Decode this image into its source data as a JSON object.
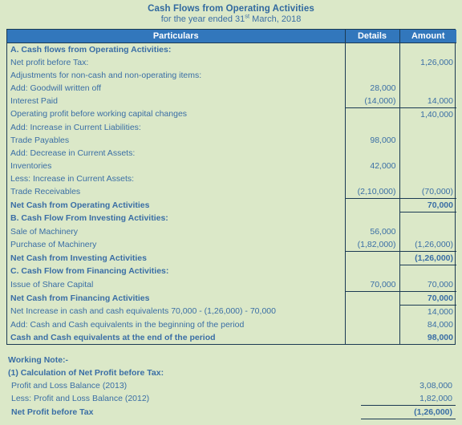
{
  "document": {
    "title": "Cash Flows from Operating Activities",
    "subtitle_prefix": "for the year ended 31",
    "subtitle_sup": "st",
    "subtitle_suffix": " March, 2018"
  },
  "colors": {
    "page_background": "#dbe8c8",
    "header_blue": "#3277bc",
    "text_blue": "#3a6ea5",
    "border": "#1b3a53",
    "header_text": "#ffffff"
  },
  "table": {
    "columns": [
      "Particulars",
      "Details",
      "Amount"
    ],
    "rows": [
      {
        "particulars": "A. Cash flows from Operating Activities:",
        "details": "",
        "amount": "",
        "bold": true,
        "indent": 0,
        "align": "left"
      },
      {
        "particulars": "Net profit before Tax:",
        "details": "",
        "amount": "1,26,000",
        "bold": false,
        "indent": 0,
        "align": "left"
      },
      {
        "particulars": "Adjustments for non-cash and non-operating items:",
        "details": "",
        "amount": "",
        "bold": false,
        "indent": 0,
        "align": "left"
      },
      {
        "particulars": "Add: Goodwill written off",
        "details": "28,000",
        "amount": "",
        "bold": false,
        "indent": 0,
        "align": "left"
      },
      {
        "particulars": "Interest Paid",
        "details": "(14,000)",
        "amount": "14,000",
        "bold": false,
        "indent": 1,
        "align": "left",
        "rule_below_details": true,
        "rule_below_amount": true
      },
      {
        "particulars": "Operating profit before working capital changes",
        "details": "",
        "amount": "1,40,000",
        "bold": false,
        "indent": 0,
        "align": "left"
      },
      {
        "particulars": "Add: Increase in Current Liabilities:",
        "details": "",
        "amount": "",
        "bold": false,
        "indent": 0,
        "align": "left"
      },
      {
        "particulars": "Trade Payables",
        "details": "98,000",
        "amount": "",
        "bold": false,
        "indent": 1,
        "align": "left"
      },
      {
        "particulars": "Add: Decrease in Current Assets:",
        "details": "",
        "amount": "",
        "bold": false,
        "indent": 0,
        "align": "left"
      },
      {
        "particulars": "Inventories",
        "details": "42,000",
        "amount": "",
        "bold": false,
        "indent": 1,
        "align": "left"
      },
      {
        "particulars": "Less: Increase in Current Assets:",
        "details": "",
        "amount": "",
        "bold": false,
        "indent": 0,
        "align": "left"
      },
      {
        "particulars": "Trade Receivables",
        "details": "(2,10,000)",
        "amount": "(70,000)",
        "bold": false,
        "indent": 1,
        "align": "left",
        "rule_below_details": true,
        "rule_below_amount": true
      },
      {
        "particulars": "Net Cash from Operating Activities",
        "details": "",
        "amount": "70,000",
        "bold": true,
        "indent": 0,
        "align": "right",
        "rule_below_amount": true
      },
      {
        "particulars": "B. Cash Flow From Investing Activities:",
        "details": "",
        "amount": "",
        "bold": true,
        "indent": 0,
        "align": "left"
      },
      {
        "particulars": "Sale of Machinery",
        "details": "56,000",
        "amount": "",
        "bold": false,
        "indent": 0,
        "align": "left"
      },
      {
        "particulars": "Purchase of Machinery",
        "details": "(1,82,000)",
        "amount": "(1,26,000)",
        "bold": false,
        "indent": 0,
        "align": "left",
        "rule_below_details": true,
        "rule_below_amount": true
      },
      {
        "particulars": "Net Cash from Investing Activities",
        "details": "",
        "amount": "(1,26,000)",
        "bold": true,
        "indent": 0,
        "align": "right",
        "rule_below_amount": true
      },
      {
        "particulars": "C. Cash Flow from Financing  Activities:",
        "details": "",
        "amount": "",
        "bold": true,
        "indent": 0,
        "align": "left"
      },
      {
        "particulars": "Issue of Share Capital",
        "details": "70,000",
        "amount": "70,000",
        "bold": false,
        "indent": 0,
        "align": "left",
        "rule_below_details": true,
        "rule_below_amount": true
      },
      {
        "particulars": "Net Cash from Financing  Activities",
        "details": "",
        "amount": "70,000",
        "bold": true,
        "indent": 0,
        "align": "right",
        "rule_below_amount": true
      },
      {
        "particulars": "Net Increase in cash and cash equivalents  70,000 - (1,26,000) - 70,000",
        "details": "",
        "amount": "14,000",
        "bold": false,
        "indent": 0,
        "align": "left"
      },
      {
        "particulars": "Add: Cash and Cash  equivalents in the beginning of the period",
        "details": "",
        "amount": "84,000",
        "bold": false,
        "indent": 0,
        "align": "left"
      },
      {
        "particulars": "Cash and Cash  equivalents at the end of the period",
        "details": "",
        "amount": "98,000",
        "bold": true,
        "indent": 0,
        "align": "right"
      }
    ]
  },
  "working_note": {
    "heading": "Working Note:-",
    "item_heading": "(1) Calculation of Net Profit before Tax:",
    "lines": [
      {
        "label": "Profit and Loss Balance (2013)",
        "value": "3,08,000",
        "bold": false,
        "align": "left",
        "rule_top": false,
        "rule_bottom": false
      },
      {
        "label": "Less: Profit and Loss Balance (2012)",
        "value": "1,82,000",
        "bold": false,
        "align": "left",
        "rule_top": false,
        "rule_bottom": true
      },
      {
        "label": "Net Profit before Tax",
        "value": "(1,26,000)",
        "bold": true,
        "align": "right",
        "rule_top": false,
        "rule_bottom": true
      }
    ]
  }
}
